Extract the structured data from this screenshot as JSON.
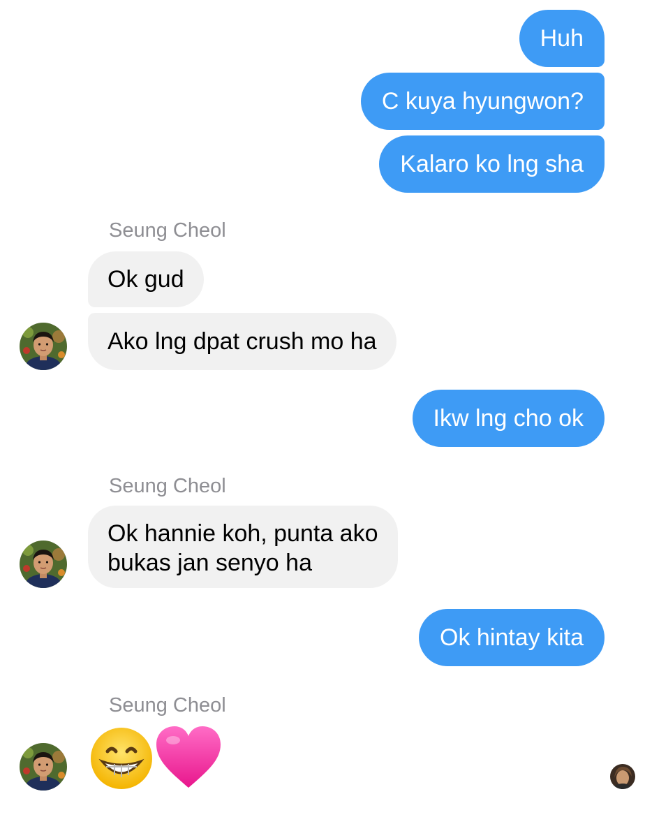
{
  "conversation": {
    "contact_name": "Seung Cheol",
    "messages": [
      {
        "from": "me",
        "text": "Huh"
      },
      {
        "from": "me",
        "text": "C kuya hyungwon?"
      },
      {
        "from": "me",
        "text": "Kalaro ko lng sha"
      },
      {
        "from": "contact",
        "sender": "Seung Cheol",
        "text": "Ok gud"
      },
      {
        "from": "contact",
        "text": "Ako lng dpat crush mo ha"
      },
      {
        "from": "me",
        "text": "Ikw lng cho ok"
      },
      {
        "from": "contact",
        "sender": "Seung Cheol",
        "line1": "Ok hannie koh, punta ako",
        "line2": "bukas jan senyo ha"
      },
      {
        "from": "me",
        "text": "Ok hintay kita"
      },
      {
        "from": "contact",
        "sender": "Seung Cheol",
        "emojis": [
          "grinning-face-emoji",
          "pink-heart-emoji"
        ]
      }
    ]
  },
  "colors": {
    "outgoing_bubble": "#3e9bf5",
    "incoming_bubble": "#f1f1f1",
    "sender_name": "#8e8e93"
  }
}
